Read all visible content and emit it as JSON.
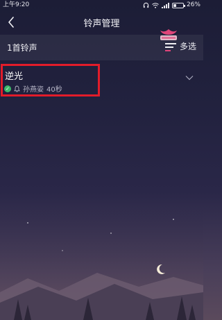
{
  "status_bar": {
    "time": "上午9:20",
    "battery": "26%",
    "icons": [
      "headphones-icon",
      "wifi-icon",
      "signal-icon",
      "battery-icon"
    ]
  },
  "header": {
    "title": "铃声管理",
    "back_icon": "back-chevron-icon"
  },
  "toolbar": {
    "count": "1首铃声",
    "multi_select": "多选"
  },
  "ringtones": [
    {
      "name": "逆光",
      "artist": "孙燕姿",
      "duration": "40秒",
      "status": "selected"
    }
  ],
  "colors": {
    "accent_check": "#3dbb6b",
    "highlight_box": "#e21c2a",
    "background_top": "#1c1d36",
    "background_bottom": "#5b4a5c"
  }
}
